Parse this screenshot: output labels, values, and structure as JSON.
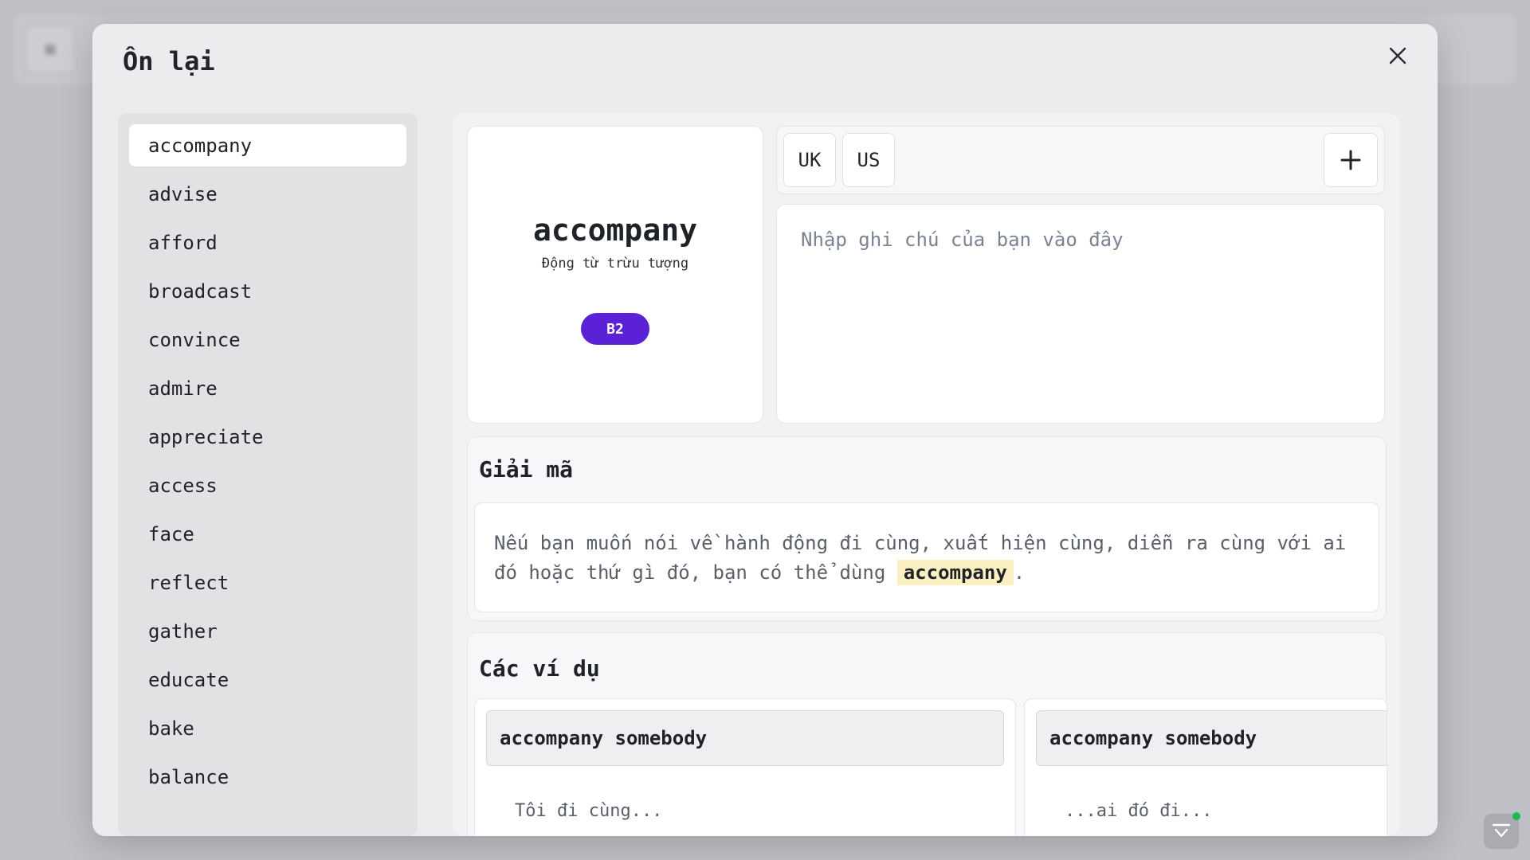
{
  "modal": {
    "title": "Ôn lại",
    "close_icon": "close-icon"
  },
  "word_list": [
    {
      "label": "accompany",
      "active": true
    },
    {
      "label": "advise"
    },
    {
      "label": "afford"
    },
    {
      "label": "broadcast"
    },
    {
      "label": "convince"
    },
    {
      "label": "admire"
    },
    {
      "label": "appreciate"
    },
    {
      "label": "access"
    },
    {
      "label": "face"
    },
    {
      "label": "reflect"
    },
    {
      "label": "gather"
    },
    {
      "label": "educate"
    },
    {
      "label": "bake"
    },
    {
      "label": "balance"
    }
  ],
  "card": {
    "word": "accompany",
    "pos": "Động từ trừu tượng",
    "level": "B2",
    "level_color": "#5b21d6"
  },
  "pronunciation": {
    "uk": "UK",
    "us": "US",
    "add_icon": "plus-icon"
  },
  "note": {
    "placeholder": "Nhập ghi chú của bạn vào đây",
    "value": ""
  },
  "decode": {
    "title": "Giải mã",
    "text_before": "Nếu bạn muốn nói về hành động đi cùng, xuất hiện cùng, diễn ra cùng với ai đó hoặc thứ gì đó, bạn có thể dùng ",
    "highlight": "accompany",
    "text_after": "."
  },
  "examples": {
    "title": "Các ví dụ",
    "items": [
      {
        "pattern": "accompany somebody",
        "sentence": "Tôi đi cùng...",
        "highlight_color": "#fbf0c2"
      },
      {
        "pattern": "accompany somebody",
        "sentence": "...ai đó đi..."
      }
    ]
  },
  "colors": {
    "accent": "#5b21d6",
    "highlight": "#fbf0c2",
    "status_online": "#1fb855"
  }
}
